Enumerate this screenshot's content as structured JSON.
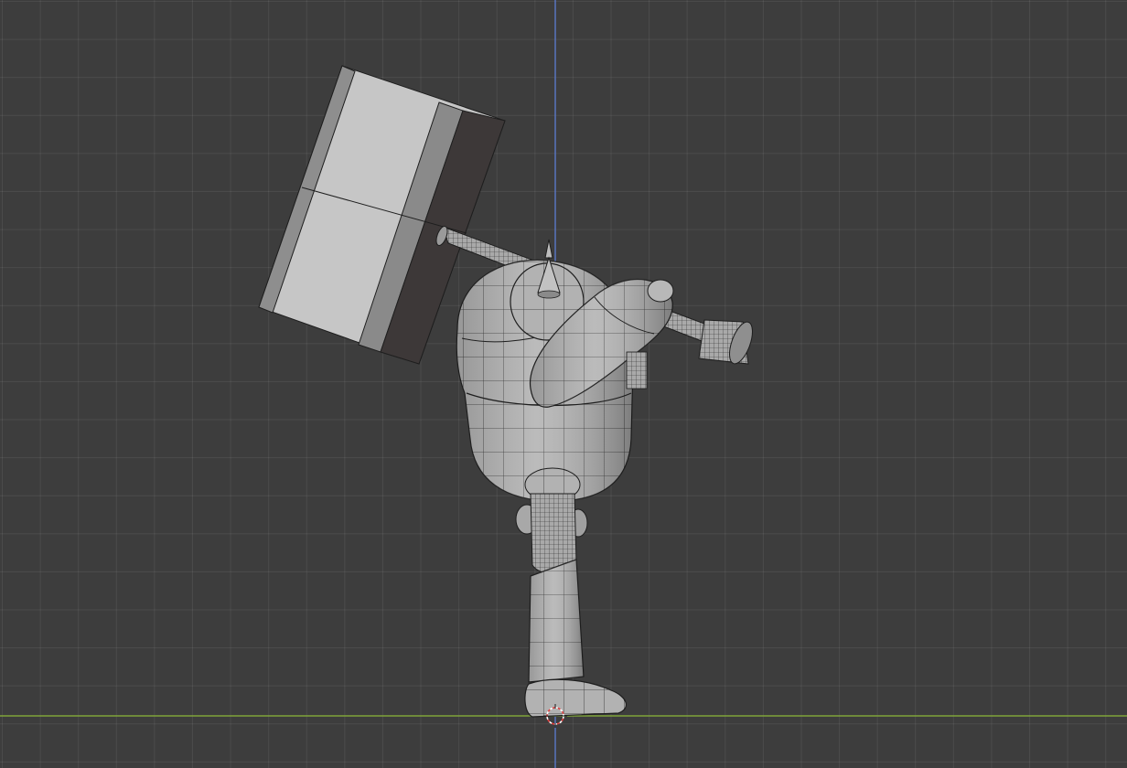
{
  "viewport": {
    "mode": "3D Viewport",
    "shading": "solid-with-wireframe",
    "grid": true
  },
  "colors": {
    "background": "#3d3d3d",
    "grid_line": "#4a4a4a",
    "axis_z": "#5a78c8",
    "axis_y": "#7fa43a",
    "mesh_light": "#c4c4c4",
    "mesh_mid": "#9a9a9a",
    "mesh_dark": "#3f3b3b",
    "wire": "#1f1f1f",
    "cursor_red": "#e04040",
    "cursor_white": "#ffffff"
  },
  "icons": {
    "cursor": "3d-cursor-icon"
  }
}
